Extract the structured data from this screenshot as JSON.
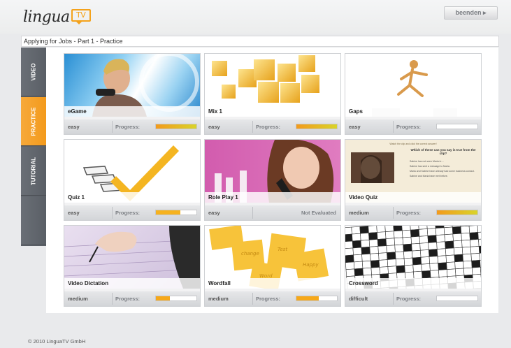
{
  "app": {
    "logo_text": "lingua",
    "logo_badge": "TV",
    "exit_label": "beenden ▸",
    "breadcrumb": "Applying for Jobs - Part 1 - Practice",
    "copyright": "© 2010 LinguaTV GmbH"
  },
  "sidebar": {
    "tabs": [
      {
        "label": "VIDEO",
        "active": false
      },
      {
        "label": "PRACTICE",
        "active": true
      },
      {
        "label": "TUTORIAL",
        "active": false
      },
      {
        "label": "",
        "active": false
      }
    ]
  },
  "exercises": [
    {
      "title": "eGame",
      "level": "easy",
      "progress_label": "Progress:",
      "progress": 1.0,
      "status": "",
      "bar_color": "#f2b320"
    },
    {
      "title": "Mix 1",
      "level": "easy",
      "progress_label": "Progress:",
      "progress": 1.0,
      "status": "",
      "bar_color": "#f2b320"
    },
    {
      "title": "Gaps",
      "level": "easy",
      "progress_label": "Progress:",
      "progress": 0.0,
      "status": "",
      "bar_color": "#f2b320"
    },
    {
      "title": "Quiz 1",
      "level": "easy",
      "progress_label": "Progress:",
      "progress": 0.6,
      "status": "",
      "bar_color": "#f6b21e"
    },
    {
      "title": "Role Play 1",
      "level": "easy",
      "progress_label": "",
      "progress": null,
      "status": "Not Evaluated",
      "bar_color": ""
    },
    {
      "title": "Video Quiz",
      "level": "medium",
      "progress_label": "Progress:",
      "progress": 1.0,
      "status": "",
      "bar_color": "#f2b320"
    },
    {
      "title": "Video Dictation",
      "level": "medium",
      "progress_label": "Progress:",
      "progress": 0.35,
      "status": "",
      "bar_color": "#f6a81a"
    },
    {
      "title": "Wordfall",
      "level": "medium",
      "progress_label": "Progress:",
      "progress": 0.55,
      "status": "",
      "bar_color": "#f6a81a"
    },
    {
      "title": "Crossword",
      "level": "difficult",
      "progress_label": "Progress:",
      "progress": 0.0,
      "status": "",
      "bar_color": "#f2b320"
    }
  ],
  "video_quiz_thumb": {
    "prompt": "Watch the clip and click the correct answer!",
    "question": "Which of these can you say is true from the clip?",
    "options": [
      "Sabine has not seen Maria in ...",
      "Sabine has sent a message to Maria.",
      "Maria and Sabine have already had some business contact.",
      "Sabine and Maria have met before."
    ]
  },
  "wordfall_notes": [
    "change",
    "Test",
    "Happy",
    "Word"
  ]
}
